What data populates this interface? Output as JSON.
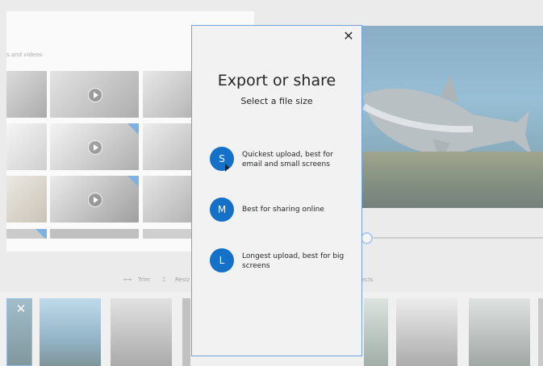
{
  "library": {
    "hint_text": "s and videos"
  },
  "toolbar": {
    "trim_label": "Trim",
    "resize_label": "Resiz",
    "effects_label": "ects"
  },
  "storyboard": {
    "close_glyph": "✕"
  },
  "dialog": {
    "close_glyph": "✕",
    "title": "Export or share",
    "subtitle": "Select a file size",
    "options": [
      {
        "letter": "S",
        "label": "Quickest upload, best for email and small screens"
      },
      {
        "letter": "M",
        "label": "Best for sharing online"
      },
      {
        "letter": "L",
        "label": "Longest upload, best for big screens"
      }
    ]
  },
  "colors": {
    "accent": "#1570c7",
    "dialog_border": "#6ea3dc",
    "dialog_bg": "#f2f2f2"
  }
}
